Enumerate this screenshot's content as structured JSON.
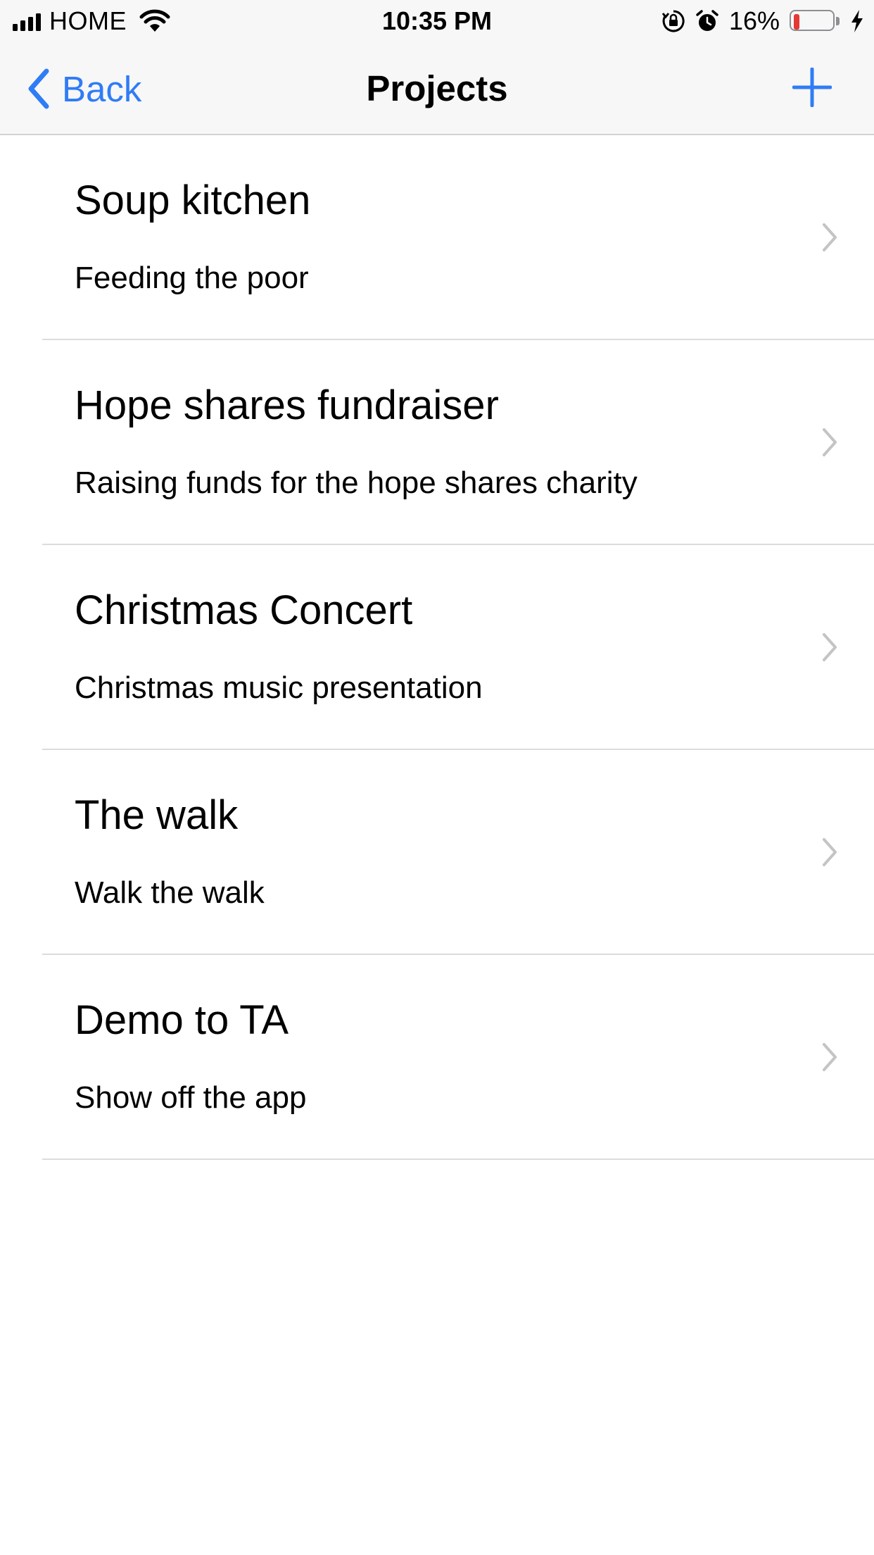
{
  "status_bar": {
    "carrier": "HOME",
    "time": "10:35 PM",
    "battery_percent": "16%",
    "battery_level_fraction": 0.16,
    "battery_level_color": "#e53935",
    "icons": [
      "signal-icon",
      "wifi-icon",
      "orientation-lock-icon",
      "alarm-icon",
      "battery-icon",
      "charging-bolt-icon"
    ]
  },
  "nav": {
    "back_label": "Back",
    "title": "Projects",
    "add_icon": "plus-icon",
    "tint_color": "#2f7cf6"
  },
  "projects": [
    {
      "title": "Soup kitchen",
      "subtitle": "Feeding the poor"
    },
    {
      "title": "Hope shares fundraiser",
      "subtitle": "Raising funds for the hope shares charity"
    },
    {
      "title": "Christmas Concert",
      "subtitle": "Christmas music presentation"
    },
    {
      "title": "The walk",
      "subtitle": "Walk the walk"
    },
    {
      "title": "Demo to TA",
      "subtitle": "Show off the app"
    }
  ]
}
